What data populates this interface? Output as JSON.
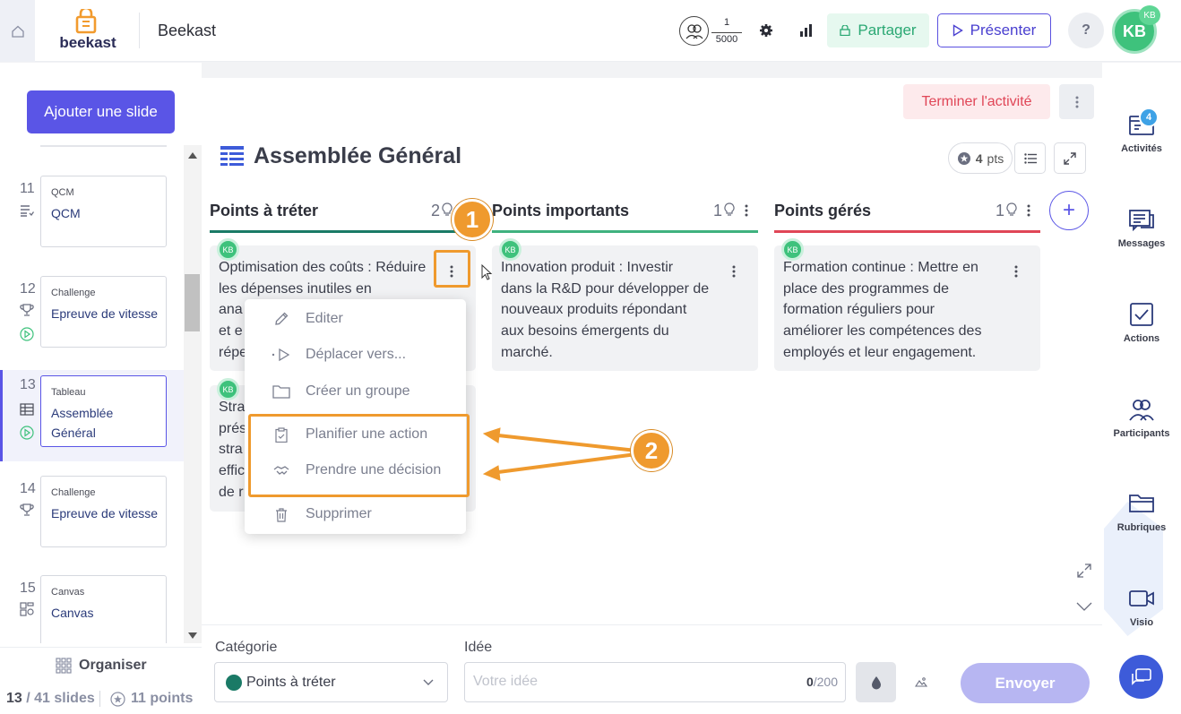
{
  "app": {
    "title": "Beekast",
    "logo_text": "beekast"
  },
  "header": {
    "participants_current": "1",
    "participants_max": "5000",
    "share_label": "Partager",
    "present_label": "Présenter",
    "help_label": "?",
    "avatar_initials": "KB",
    "avatar_small": "KB"
  },
  "left": {
    "add_slide_label": "Ajouter une slide",
    "slides": [
      {
        "num": "11",
        "type": "QCM",
        "title": "QCM",
        "icon": "list-check-icon"
      },
      {
        "num": "12",
        "type": "Challenge",
        "title": "Epreuve de vitesse",
        "icon": "trophy-icon"
      },
      {
        "num": "13",
        "type": "Tableau",
        "title": "Assemblée Général",
        "icon": "table-icon",
        "selected": true
      },
      {
        "num": "14",
        "type": "Challenge",
        "title": "Epreuve de vitesse",
        "icon": "trophy-icon"
      },
      {
        "num": "15",
        "type": "Canvas",
        "title": "Canvas",
        "icon": "canvas-icon"
      }
    ],
    "organiser_label": "Organiser",
    "slide_current": "13",
    "slide_total": "/ 41 slides",
    "points_label": "11 points"
  },
  "board": {
    "terminate_label": "Terminer l'activité",
    "title": "Assemblée Général",
    "points_value": "4",
    "points_unit": "pts",
    "columns": [
      {
        "name": "Points à tréter",
        "count": "2",
        "color": "#1a7a66"
      },
      {
        "name": "Points importants",
        "count": "1",
        "color": "#3fb27f"
      },
      {
        "name": "Points gérés",
        "count": "1",
        "color": "#e04657"
      }
    ],
    "cards": [
      {
        "author": "KB",
        "text": "Optimisation des coûts : Réduire les dépenses inutiles en ana...",
        "lines": [
          "Optimisation des coûts : Réduire",
          "les dépenses inutiles en",
          "ana",
          "et e",
          "répe"
        ]
      },
      {
        "author": "KB",
        "lines": [
          "Stra",
          "prés",
          "stra",
          "effic",
          "de r"
        ]
      },
      {
        "author": "KB",
        "lines": [
          "Innovation produit : Investir",
          "dans la R&D pour développer de",
          "nouveaux produits répondant",
          "aux besoins émergents du",
          "marché."
        ]
      },
      {
        "author": "KB",
        "lines": [
          "Formation continue : Mettre en",
          "place des programmes de",
          "formation réguliers pour",
          "améliorer les compétences des",
          "employés et leur engagement."
        ]
      }
    ]
  },
  "menu": {
    "items": [
      {
        "label": "Editer",
        "icon": "pencil-icon"
      },
      {
        "label": "Déplacer vers...",
        "icon": "move-icon"
      },
      {
        "label": "Créer un groupe",
        "icon": "folder-icon"
      },
      {
        "label": "Planifier une action",
        "icon": "clipboard-icon"
      },
      {
        "label": "Prendre une décision",
        "icon": "handshake-icon"
      },
      {
        "label": "Supprimer",
        "icon": "trash-icon"
      }
    ]
  },
  "annotations": {
    "badge1": "1",
    "badge2": "2",
    "highlight_color": "#ef9a2e"
  },
  "composer": {
    "category_label": "Catégorie",
    "category_value": "Points à tréter",
    "idea_label": "Idée",
    "idea_placeholder": "Votre idée",
    "char_count": "0",
    "char_max": "/200",
    "send_label": "Envoyer"
  },
  "right": {
    "items": [
      {
        "label": "Activités",
        "icon": "activities-icon",
        "badge": "4"
      },
      {
        "label": "Messages",
        "icon": "messages-icon"
      },
      {
        "label": "Actions",
        "icon": "actions-icon"
      },
      {
        "label": "Participants",
        "icon": "participants-icon"
      },
      {
        "label": "Rubriques",
        "icon": "folder-icon"
      },
      {
        "label": "Visio",
        "icon": "video-icon"
      }
    ]
  },
  "colors": {
    "accent": "#5a55e6",
    "green": "#3ec27c",
    "red": "#e04657",
    "orange": "#ef9a2e"
  }
}
